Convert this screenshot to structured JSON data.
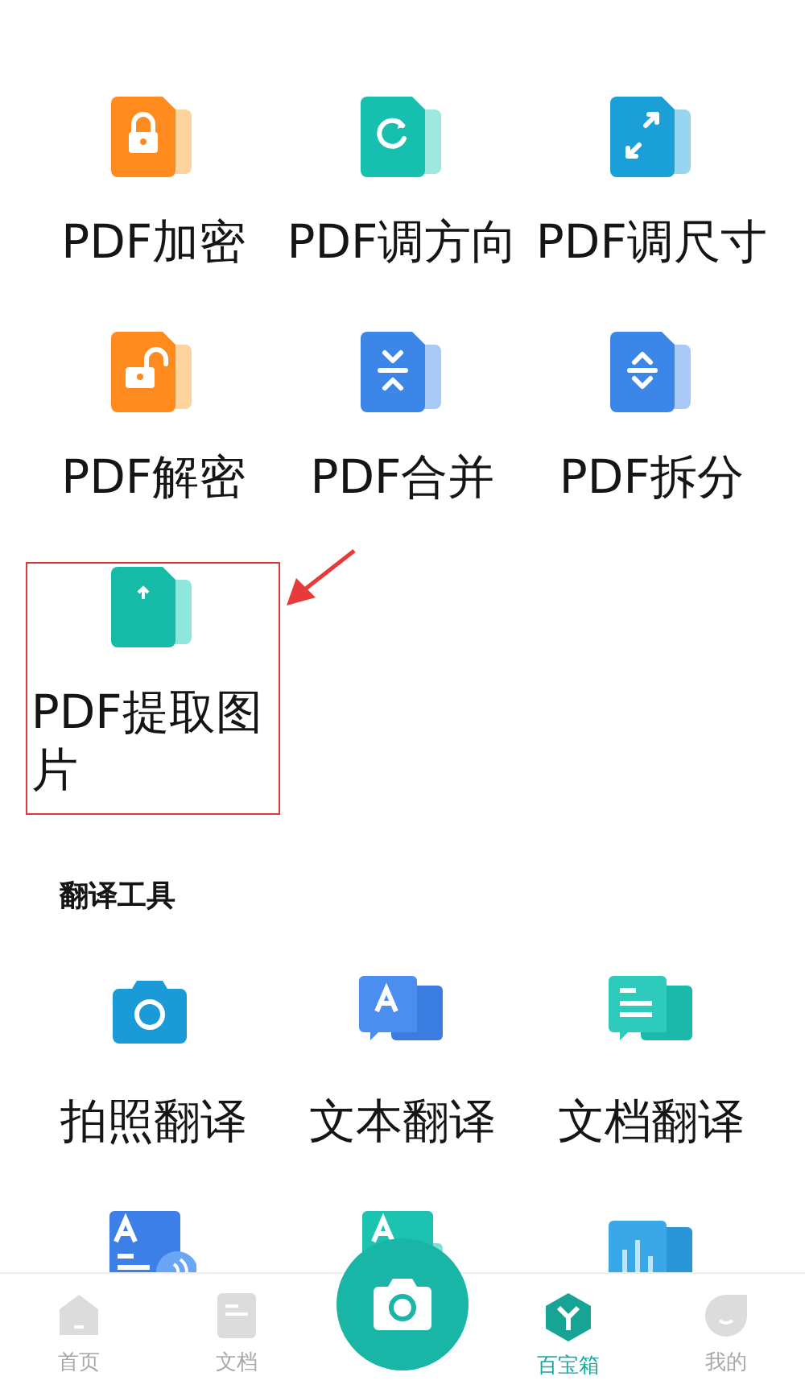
{
  "pdf_tools": {
    "items": [
      {
        "label": "PDF加密",
        "highlighted": false
      },
      {
        "label": "PDF调方向",
        "highlighted": false
      },
      {
        "label": "PDF调尺寸",
        "highlighted": false
      },
      {
        "label": "PDF解密",
        "highlighted": false
      },
      {
        "label": "PDF合并",
        "highlighted": false
      },
      {
        "label": "PDF拆分",
        "highlighted": false
      },
      {
        "label": "PDF提取图片",
        "highlighted": true
      }
    ]
  },
  "translate_tools": {
    "title": "翻译工具",
    "items": [
      {
        "kind": "labeled",
        "label": "拍照翻译"
      },
      {
        "kind": "labeled",
        "label": "文本翻译"
      },
      {
        "kind": "labeled",
        "label": "文档翻译"
      },
      {
        "kind": "icon-only"
      },
      {
        "kind": "icon-only"
      },
      {
        "kind": "icon-only"
      }
    ]
  },
  "bottom_nav": {
    "tabs": [
      {
        "label": "首页",
        "selected": false
      },
      {
        "label": "文档",
        "selected": false
      },
      {
        "label": "百宝箱",
        "selected": true
      },
      {
        "label": "我的",
        "selected": false
      }
    ]
  }
}
